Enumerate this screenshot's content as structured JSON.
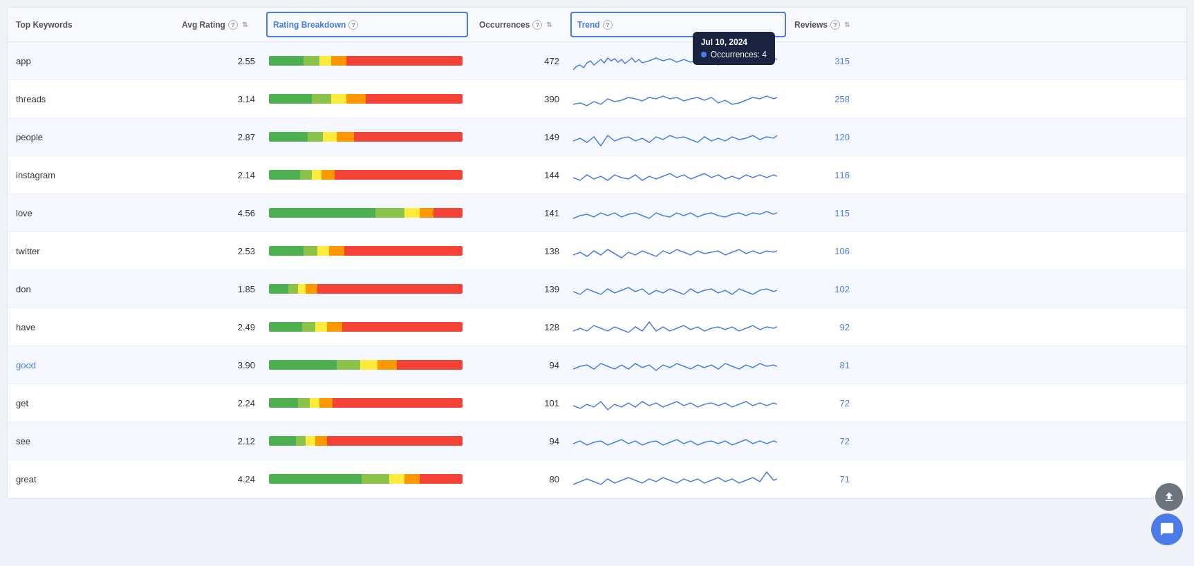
{
  "header": {
    "col_keyword": "Top Keywords",
    "col_avg_rating": "Avg Rating",
    "col_rating_breakdown": "Rating Breakdown",
    "col_occurrences": "Occurrences",
    "col_trend": "Trend",
    "col_reviews": "Reviews"
  },
  "tooltip": {
    "date": "Jul 10, 2024",
    "label": "Occurrences:",
    "value": "4"
  },
  "rows": [
    {
      "keyword": "app",
      "highlighted": false,
      "rating": "2.55",
      "occurrences": "472",
      "reviews": "315",
      "bar": [
        {
          "color": "#4caf50",
          "pct": 18
        },
        {
          "color": "#8bc34a",
          "pct": 8
        },
        {
          "color": "#ffeb3b",
          "pct": 6
        },
        {
          "color": "#ff9800",
          "pct": 8
        },
        {
          "color": "#f44336",
          "pct": 60
        }
      ]
    },
    {
      "keyword": "threads",
      "highlighted": false,
      "rating": "3.14",
      "occurrences": "390",
      "reviews": "258",
      "bar": [
        {
          "color": "#4caf50",
          "pct": 22
        },
        {
          "color": "#8bc34a",
          "pct": 10
        },
        {
          "color": "#ffeb3b",
          "pct": 8
        },
        {
          "color": "#ff9800",
          "pct": 10
        },
        {
          "color": "#f44336",
          "pct": 50
        }
      ]
    },
    {
      "keyword": "people",
      "highlighted": false,
      "rating": "2.87",
      "occurrences": "149",
      "reviews": "120",
      "bar": [
        {
          "color": "#4caf50",
          "pct": 20
        },
        {
          "color": "#8bc34a",
          "pct": 8
        },
        {
          "color": "#ffeb3b",
          "pct": 7
        },
        {
          "color": "#ff9800",
          "pct": 9
        },
        {
          "color": "#f44336",
          "pct": 56
        }
      ]
    },
    {
      "keyword": "instagram",
      "highlighted": false,
      "rating": "2.14",
      "occurrences": "144",
      "reviews": "116",
      "bar": [
        {
          "color": "#4caf50",
          "pct": 16
        },
        {
          "color": "#8bc34a",
          "pct": 6
        },
        {
          "color": "#ffeb3b",
          "pct": 5
        },
        {
          "color": "#ff9800",
          "pct": 7
        },
        {
          "color": "#f44336",
          "pct": 66
        }
      ]
    },
    {
      "keyword": "love",
      "highlighted": false,
      "rating": "4.56",
      "occurrences": "141",
      "reviews": "115",
      "bar": [
        {
          "color": "#4caf50",
          "pct": 55
        },
        {
          "color": "#8bc34a",
          "pct": 15
        },
        {
          "color": "#ffeb3b",
          "pct": 8
        },
        {
          "color": "#ff9800",
          "pct": 7
        },
        {
          "color": "#f44336",
          "pct": 15
        }
      ]
    },
    {
      "keyword": "twitter",
      "highlighted": false,
      "rating": "2.53",
      "occurrences": "138",
      "reviews": "106",
      "bar": [
        {
          "color": "#4caf50",
          "pct": 18
        },
        {
          "color": "#8bc34a",
          "pct": 7
        },
        {
          "color": "#ffeb3b",
          "pct": 6
        },
        {
          "color": "#ff9800",
          "pct": 8
        },
        {
          "color": "#f44336",
          "pct": 61
        }
      ]
    },
    {
      "keyword": "don",
      "highlighted": false,
      "rating": "1.85",
      "occurrences": "139",
      "reviews": "102",
      "bar": [
        {
          "color": "#4caf50",
          "pct": 10
        },
        {
          "color": "#8bc34a",
          "pct": 5
        },
        {
          "color": "#ffeb3b",
          "pct": 4
        },
        {
          "color": "#ff9800",
          "pct": 6
        },
        {
          "color": "#f44336",
          "pct": 75
        }
      ]
    },
    {
      "keyword": "have",
      "highlighted": false,
      "rating": "2.49",
      "occurrences": "128",
      "reviews": "92",
      "bar": [
        {
          "color": "#4caf50",
          "pct": 17
        },
        {
          "color": "#8bc34a",
          "pct": 7
        },
        {
          "color": "#ffeb3b",
          "pct": 6
        },
        {
          "color": "#ff9800",
          "pct": 8
        },
        {
          "color": "#f44336",
          "pct": 62
        }
      ]
    },
    {
      "keyword": "good",
      "highlighted": true,
      "rating": "3.90",
      "occurrences": "94",
      "reviews": "81",
      "bar": [
        {
          "color": "#4caf50",
          "pct": 35
        },
        {
          "color": "#8bc34a",
          "pct": 12
        },
        {
          "color": "#ffeb3b",
          "pct": 9
        },
        {
          "color": "#ff9800",
          "pct": 10
        },
        {
          "color": "#f44336",
          "pct": 34
        }
      ]
    },
    {
      "keyword": "get",
      "highlighted": false,
      "rating": "2.24",
      "occurrences": "101",
      "reviews": "72",
      "bar": [
        {
          "color": "#4caf50",
          "pct": 15
        },
        {
          "color": "#8bc34a",
          "pct": 6
        },
        {
          "color": "#ffeb3b",
          "pct": 5
        },
        {
          "color": "#ff9800",
          "pct": 7
        },
        {
          "color": "#f44336",
          "pct": 67
        }
      ]
    },
    {
      "keyword": "see",
      "highlighted": false,
      "rating": "2.12",
      "occurrences": "94",
      "reviews": "72",
      "bar": [
        {
          "color": "#4caf50",
          "pct": 14
        },
        {
          "color": "#8bc34a",
          "pct": 5
        },
        {
          "color": "#ffeb3b",
          "pct": 5
        },
        {
          "color": "#ff9800",
          "pct": 6
        },
        {
          "color": "#f44336",
          "pct": 70
        }
      ]
    },
    {
      "keyword": "great",
      "highlighted": false,
      "rating": "4.24",
      "occurrences": "80",
      "reviews": "71",
      "bar": [
        {
          "color": "#4caf50",
          "pct": 48
        },
        {
          "color": "#8bc34a",
          "pct": 14
        },
        {
          "color": "#ffeb3b",
          "pct": 8
        },
        {
          "color": "#ff9800",
          "pct": 8
        },
        {
          "color": "#f44336",
          "pct": 22
        }
      ]
    }
  ],
  "sparklines": [
    "M0,35 L5,30 L10,28 L15,32 L20,25 L25,22 L30,28 L35,24 L40,20 L45,25 L50,18 L55,22 L60,19 L65,24 L70,20 L75,26 L80,22 L85,18 L90,24 L95,20 L100,25 L110,22 L120,18 L130,22 L140,19 L150,24 L160,20 L170,24 L180,20 L190,26 L200,22 L210,28 L220,24 L230,20 L240,15 L250,10 L260,18 L270,5 L280,22 L290,18 L295,20",
    "M0,30 L10,28 L20,32 L30,26 L40,30 L50,22 L60,26 L70,24 L80,20 L90,22 L100,25 L110,20 L120,22 L130,18 L140,22 L150,20 L160,25 L170,22 L180,20 L190,24 L200,20 L210,28 L220,24 L230,30 L240,28 L250,24 L260,20 L270,22 L280,18 L285,20 L290,22 L295,20",
    "M0,28 L10,24 L20,30 L30,22 L40,35 L50,20 L60,28 L70,24 L80,22 L90,28 L100,24 L110,30 L120,22 L130,26 L140,20 L150,24 L160,22 L170,26 L180,30 L190,22 L200,28 L210,24 L220,28 L230,22 L240,26 L250,24 L260,20 L270,26 L280,22 L290,24 L295,20",
    "M0,26 L10,30 L20,22 L30,28 L40,24 L50,30 L60,22 L70,26 L80,28 L90,22 L100,30 L110,24 L120,28 L130,24 L140,20 L150,26 L160,22 L170,28 L180,24 L190,20 L200,26 L210,22 L220,28 L230,24 L240,28 L250,22 L260,26 L270,22 L280,26 L290,22 L295,24",
    "M0,30 L10,26 L20,24 L30,28 L40,22 L50,26 L60,22 L70,28 L80,24 L90,22 L100,26 L110,30 L120,22 L130,26 L140,28 L150,22 L160,26 L170,22 L180,28 L190,24 L200,22 L210,26 L220,28 L230,24 L240,22 L250,26 L260,22 L270,24 L280,20 L290,24 L295,22",
    "M0,28 L10,24 L20,30 L30,22 L40,28 L50,20 L60,26 L70,32 L80,24 L90,28 L100,22 L110,26 L120,30 L130,22 L140,26 L150,20 L160,24 L170,28 L180,22 L190,26 L200,24 L210,22 L220,28 L230,24 L240,20 L250,26 L260,22 L270,26 L280,22 L290,24 L295,22",
    "M0,26 L10,30 L20,22 L30,26 L40,30 L50,22 L60,28 L70,24 L80,20 L90,26 L100,22 L110,30 L120,24 L130,28 L140,22 L150,26 L160,30 L170,22 L180,28 L190,24 L200,22 L210,28 L220,24 L230,30 L240,22 L250,26 L260,30 L270,24 L280,22 L290,26 L295,24",
    "M0,28 L10,24 L20,28 L30,20 L40,24 L50,28 L60,22 L70,26 L80,30 L90,22 L100,28 L110,15 L120,28 L130,22 L140,28 L150,24 L160,20 L170,26 L180,22 L190,28 L200,24 L210,22 L220,26 L230,22 L240,28 L250,24 L260,20 L270,26 L280,22 L290,24 L295,22",
    "M0,28 L10,24 L20,22 L30,28 L40,20 L50,24 L60,28 L70,22 L80,28 L90,20 L100,26 L110,22 L120,30 L130,22 L140,26 L150,20 L160,24 L170,28 L180,22 L190,26 L200,22 L210,28 L220,20 L230,24 L240,28 L250,22 L260,26 L270,20 L280,24 L290,22 L295,24",
    "M0,26 L10,30 L20,24 L30,28 L40,20 L50,32 L60,24 L70,28 L80,22 L90,28 L100,20 L110,26 L120,22 L130,28 L140,24 L150,20 L160,26 L170,22 L180,28 L190,24 L200,22 L210,26 L220,22 L230,28 L240,24 L250,20 L260,26 L270,22 L280,26 L290,22 L295,24",
    "M0,26 L10,22 L20,28 L30,24 L40,22 L50,28 L60,24 L70,20 L80,26 L90,22 L100,28 L110,24 L120,22 L130,28 L140,24 L150,20 L160,26 L170,22 L180,28 L190,24 L200,22 L210,26 L220,22 L230,28 L240,24 L250,20 L260,26 L270,22 L280,26 L290,22 L295,24",
    "M0,30 L10,26 L20,22 L30,26 L40,30 L50,22 L60,28 L70,24 L80,20 L90,24 L100,28 L110,22 L120,26 L130,20 L140,24 L150,28 L160,22 L170,26 L180,22 L190,28 L200,24 L210,20 L220,26 L230,22 L240,28 L250,24 L260,20 L270,26 L280,12 L290,24 L295,22"
  ]
}
